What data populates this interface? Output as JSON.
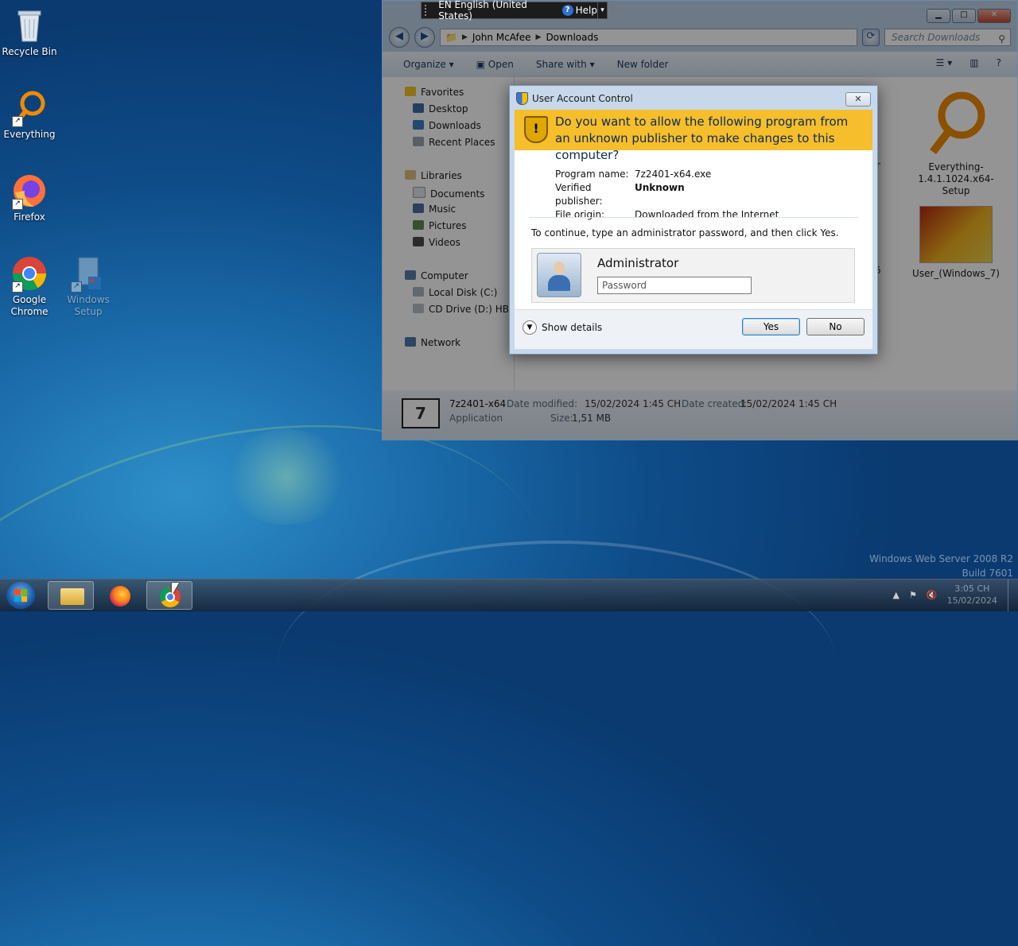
{
  "desktop": {
    "icons": [
      {
        "label": "Recycle Bin"
      },
      {
        "label": "Everything"
      },
      {
        "label": "Firefox"
      },
      {
        "label": "Google Chrome"
      },
      {
        "label": "Windows Setup"
      }
    ]
  },
  "language_bar": {
    "language": "EN English (United States)",
    "help": "Help"
  },
  "explorer": {
    "breadcrumb": [
      "John McAfee",
      "Downloads"
    ],
    "search_placeholder": "Search Downloads",
    "toolbar": {
      "organize": "Organize",
      "open": "Open",
      "share_with": "Share with",
      "new_folder": "New folder"
    },
    "nav": {
      "favorites": "Favorites",
      "desktop": "Desktop",
      "downloads": "Downloads",
      "recent_places": "Recent Places",
      "libraries": "Libraries",
      "documents": "Documents",
      "music": "Music",
      "pictures": "Pictures",
      "videos": "Videos",
      "computer": "Computer",
      "local_disk": "Local Disk (C:)",
      "cd_drive": "CD Drive (D:) HBCD",
      "network": "Network"
    },
    "files": {
      "partial_1": "ber",
      "everything_setup": "Everything-1.4.1.1024.x64-Setup",
      "partial_2": "4556",
      "user_windows": "User_(Windows_7)"
    },
    "details": {
      "name": "7z2401-x64",
      "type": "Application",
      "modified_label": "Date modified:",
      "modified": "15/02/2024 1:45 CH",
      "size_label": "Size:",
      "size": "1,51 MB",
      "created_label": "Date created:",
      "created": "15/02/2024 1:45 CH"
    }
  },
  "uac": {
    "title": "User Account Control",
    "question": "Do you want to allow the following program from an unknown publisher to make changes to this computer?",
    "program_name_label": "Program name:",
    "program_name": "7z2401-x64.exe",
    "publisher_label": "Verified publisher:",
    "publisher": "Unknown",
    "origin_label": "File origin:",
    "origin": "Downloaded from the Internet",
    "instruction": "To continue, type an administrator password, and then click Yes.",
    "account": "Administrator",
    "password_placeholder": "Password",
    "show_details": "Show details",
    "yes": "Yes",
    "no": "No"
  },
  "watermark": {
    "line1": "Windows Web Server 2008 R2",
    "line2": "Build 7601"
  },
  "taskbar": {
    "clock_time": "3:05 CH",
    "clock_date": "15/02/2024"
  }
}
